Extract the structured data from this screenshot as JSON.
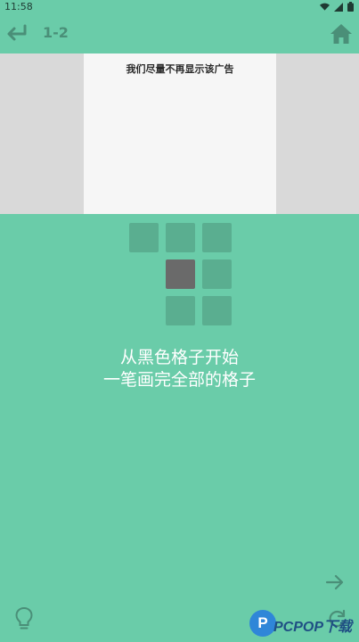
{
  "status_bar": {
    "time": "11:58",
    "icons": [
      "wifi-icon",
      "signal-icon",
      "battery-icon"
    ]
  },
  "toolbar": {
    "back_icon": "back-arrow-icon",
    "level": "1-2",
    "home_icon": "home-icon"
  },
  "ad": {
    "text": "我们尽量不再显示该广告"
  },
  "grid": {
    "cells": [
      {
        "row": 0,
        "col": 0,
        "state": "empty"
      },
      {
        "row": 0,
        "col": 1,
        "state": "empty"
      },
      {
        "row": 0,
        "col": 2,
        "state": "empty"
      },
      {
        "row": 1,
        "col": 1,
        "state": "start"
      },
      {
        "row": 1,
        "col": 2,
        "state": "empty"
      },
      {
        "row": 2,
        "col": 1,
        "state": "empty"
      },
      {
        "row": 2,
        "col": 2,
        "state": "empty"
      }
    ]
  },
  "instructions": {
    "line1": "从黑色格子开始",
    "line2": "一笔画完全部的格子"
  },
  "footer": {
    "next_icon": "arrow-right-icon",
    "hint_icon": "lightbulb-icon"
  },
  "watermark": {
    "logo_letter": "P",
    "text": "PCPOP下载"
  },
  "colors": {
    "background": "#6acca9",
    "cell": "#5aae90",
    "start_cell": "#6a6a6a"
  }
}
